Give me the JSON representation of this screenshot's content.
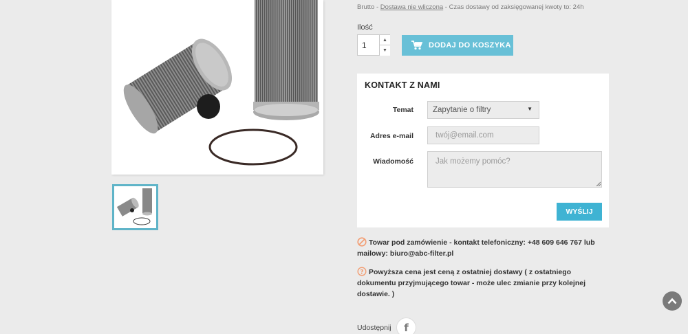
{
  "delivery": {
    "prefix": "Brutto - ",
    "link": "Dostawa nie wliczona",
    "suffix": " - Czas dostawy od zaksięgowanej kwoty to: 24h"
  },
  "quantity": {
    "label": "Ilość",
    "value": "1"
  },
  "cart": {
    "add_label": "DODAJ DO KOSZYKA"
  },
  "contact": {
    "title": "KONTAKT Z NAMI",
    "topic_label": "Temat",
    "topic_selected": "Zapytanie o filtry",
    "email_label": "Adres e-mail",
    "email_placeholder": "twój@email.com",
    "message_label": "Wiadomość",
    "message_placeholder": "Jak możemy pomóc?",
    "send_label": "WYŚLIJ"
  },
  "notes": {
    "availability": "Towar pod zamówienie - kontakt telefoniczny: +48 609 646 767 lub mailowy: biuro@abc-filter.pl",
    "price_info": "Powyższa cena jest ceną z ostatniej dostawy ( z ostatniego dokumentu przyjmującego towar - może ulec zmianie przy kolejnej dostawie. )"
  },
  "share": {
    "label": "Udostępnij",
    "facebook_glyph": "f"
  },
  "icons": {
    "cart": "cart-icon",
    "unavailable": "not-allowed-icon",
    "help": "question-circle-icon",
    "scroll_top": "chevron-up-icon"
  },
  "colors": {
    "accent": "#68c0d7",
    "send": "#3fb3d3",
    "warning": "#f39d72"
  }
}
